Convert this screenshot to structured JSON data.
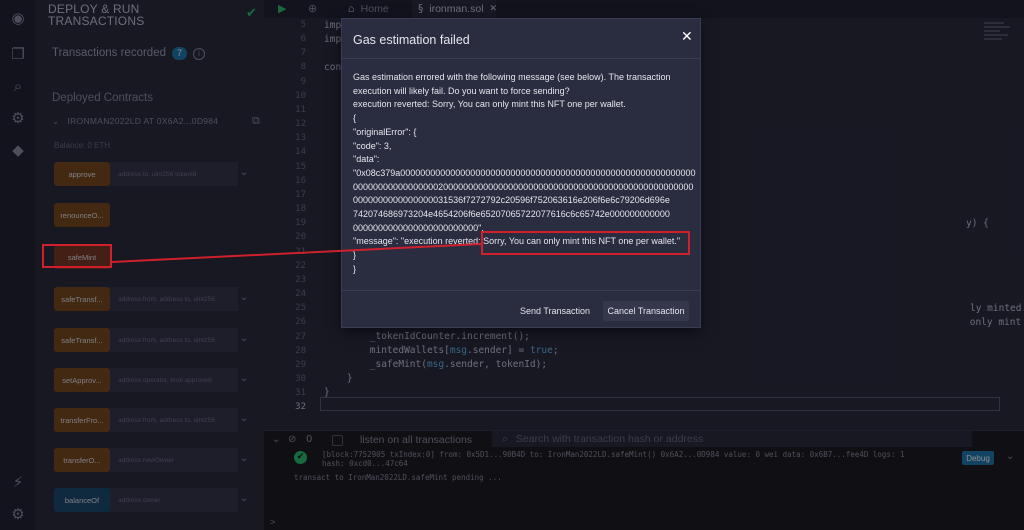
{
  "sidebar": {
    "title_line1": "DEPLOY & RUN",
    "title_line2": "TRANSACTIONS",
    "transactions_recorded": "Transactions recorded",
    "transactions_count": "7",
    "deployed_contracts": "Deployed Contracts",
    "contract_name": "IRONMAN2022LD AT 0X6A2...0D984",
    "balance": "Balance: 0 ETH",
    "functions": [
      {
        "label": "approve",
        "placeholder": "address to, uint256 tokenId",
        "color": "orange"
      },
      {
        "label": "renounceO...",
        "placeholder": "",
        "color": "orange"
      },
      {
        "label": "safeMint",
        "placeholder": "",
        "color": "red"
      },
      {
        "label": "safeTransf...",
        "placeholder": "address from, address to, uint256",
        "color": "orange"
      },
      {
        "label": "safeTransf...",
        "placeholder": "address from, address to, uint256",
        "color": "orange"
      },
      {
        "label": "setApprov...",
        "placeholder": "address operator, bool approved",
        "color": "orange"
      },
      {
        "label": "transferFro...",
        "placeholder": "address from, address to, uint256",
        "color": "orange"
      },
      {
        "label": "transferO...",
        "placeholder": "address newOwner",
        "color": "orange"
      },
      {
        "label": "balanceOf",
        "placeholder": "address owner",
        "color": "blue"
      }
    ]
  },
  "editor": {
    "tabs": [
      "Home",
      "ironman.sol"
    ],
    "line_numbers": [
      "5",
      "6",
      "7",
      "8",
      "9",
      "10",
      "11",
      "12",
      "13",
      "14",
      "15",
      "16",
      "17",
      "18",
      "19",
      "20",
      "21",
      "22",
      "23",
      "24",
      "25",
      "26",
      "27",
      "28",
      "29",
      "30",
      "31",
      "32"
    ],
    "code_partials": {
      "line5": "imp",
      "line6": "imp",
      "line8": "con",
      "line20_tail": "y) {",
      "line25_tail": "ly minted.\");",
      "line26_tail": " only mint this NFT one per wallet.\");",
      "line27": "        _tokenIdCounter.increment();",
      "line28_a": "        mintedWallets[",
      "line28_msg": "msg",
      "line28_b": ".sender] = ",
      "line28_true": "true",
      "line28_c": ";",
      "line29_a": "        _safeMint(",
      "line29_msg": "msg",
      "line29_b": ".sender, tokenId);",
      "line30": "    }",
      "line31": "}"
    }
  },
  "terminal": {
    "count": "0",
    "listen_label": "listen on all transactions",
    "search_placeholder": "Search with transaction hash or address",
    "log_line1": "[block:7752905 txIndex:0] from: 0x5D1...90B4D to: IronMan2022LD.safeMint() 0x6A2...0D984 value: 0 wei data: 0x6B7...fee4D logs: 1",
    "log_line2": "hash: 0xcd0...47c64",
    "pending": "transact to IronMan2022LD.safeMint pending ...",
    "debug_label": "Debug",
    "prompt": ">"
  },
  "modal": {
    "title": "Gas estimation failed",
    "lines": [
      "Gas estimation errored with the following message (see below). The transaction",
      "execution will likely fail. Do you want to force sending?",
      "execution reverted: Sorry, You can only mint this NFT one per wallet.",
      "{",
      "\"originalError\": {",
      "\"code\": 3,",
      "\"data\":",
      "\"0x08c379a00000000000000000000000000000000000000000000000000000000000",
      "00000000000000000200000000000000000000000000000000000000000000000000",
      "0000000000000000031536f7272792c20596f752063616e206f6e6c79206d696e",
      "742074686973204e4654206f6e65207065722077616c6c65742e000000000000",
      "0000000000000000000000000\","
    ],
    "message_key": "\"message\": \"execution reverted: ",
    "message_value": "Sorry, You can only mint this NFT one per wallet.\"",
    "closing": [
      "}",
      "}"
    ],
    "send_button": "Send Transaction",
    "cancel_button": "Cancel Transaction"
  },
  "colors": {
    "highlight": "#d0202c",
    "accent_green": "#2fbf71",
    "accent_blue": "#1f7bb5"
  }
}
